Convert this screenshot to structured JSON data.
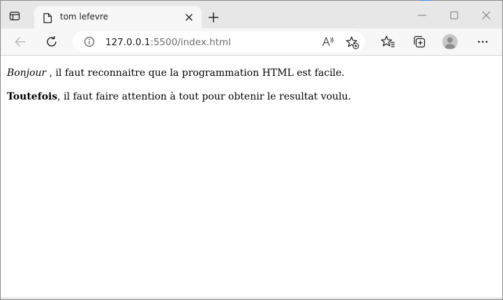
{
  "tab": {
    "title": "tom lefevre"
  },
  "address_bar": {
    "url_host": "127.0.0.1",
    "url_rest": ":5500/index.html"
  },
  "page": {
    "paragraph1": {
      "emphasis": "Bonjour",
      "text": " , il faut reconnaitre que la programmation HTML est facile."
    },
    "paragraph2": {
      "strong": "Toutefois",
      "text": ", il faut faire attention à tout pour obtenir le resultat voulu."
    }
  },
  "icons": {
    "tab_actions": "tab-actions-icon",
    "favicon": "page-icon",
    "tab_close": "close-icon",
    "new_tab": "plus-icon",
    "minimize": "minimize-icon",
    "maximize": "maximize-icon",
    "window_close": "close-icon",
    "back": "back-arrow-icon",
    "refresh": "refresh-icon",
    "site_info": "info-icon",
    "read_aloud": "read-aloud-icon",
    "add_favorite": "add-favorite-icon",
    "favorites": "favorites-icon",
    "collections": "collections-icon",
    "profile": "profile-avatar-icon",
    "more": "more-icon"
  },
  "colors": {
    "tabstrip_bg": "#e7e7e7",
    "toolbar_bg": "#f7f7f7",
    "accent": "#3d88e6"
  }
}
